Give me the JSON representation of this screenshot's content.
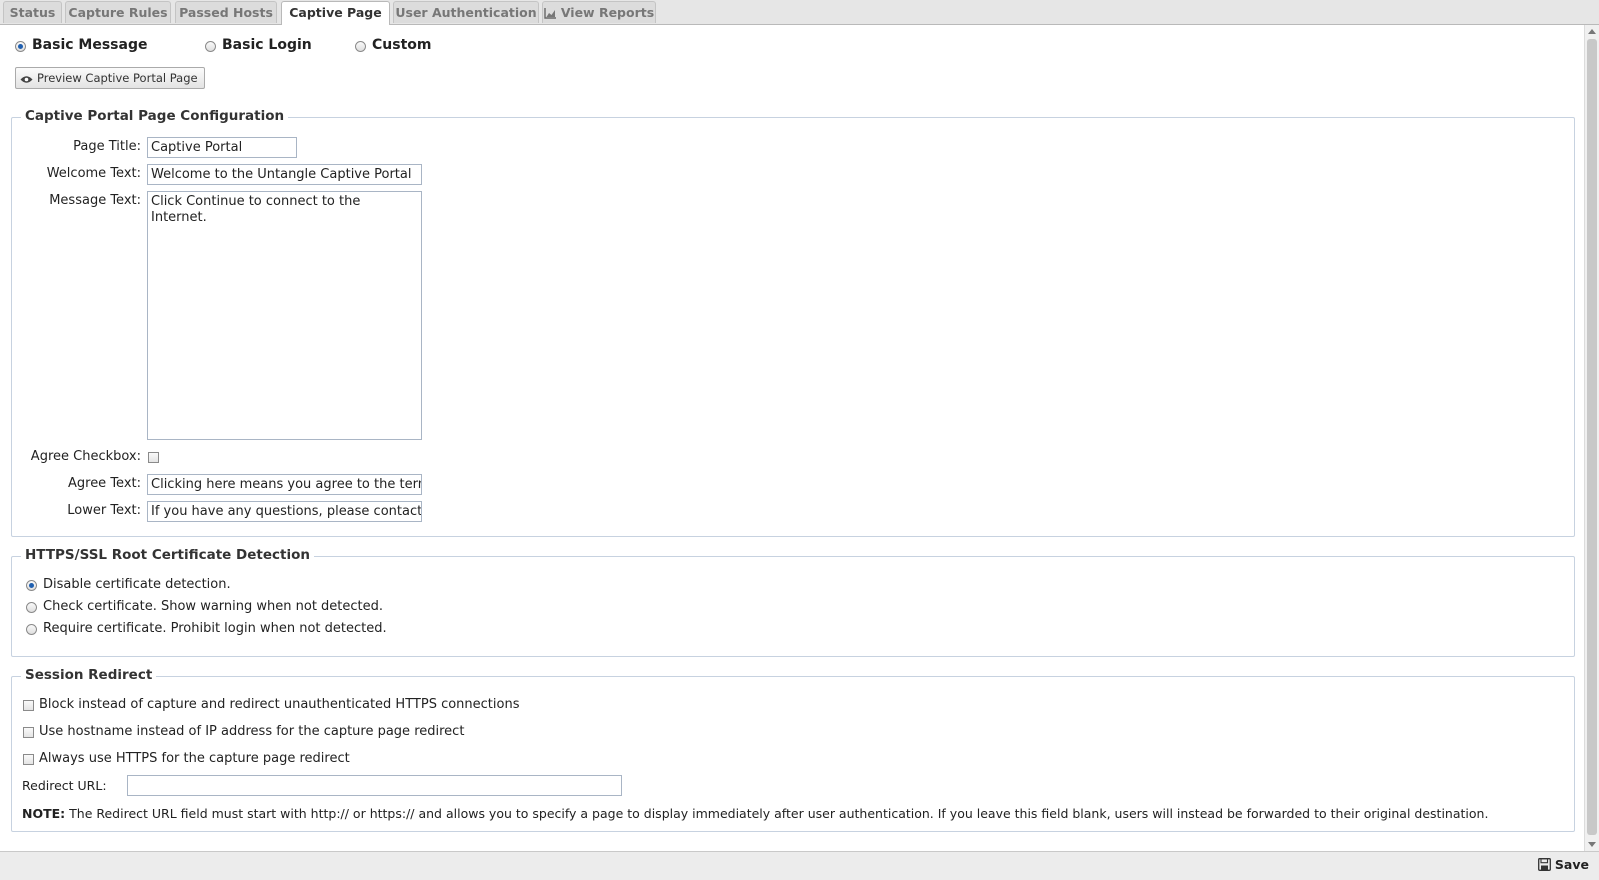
{
  "tabs": [
    {
      "label": "Status"
    },
    {
      "label": "Capture Rules"
    },
    {
      "label": "Passed Hosts"
    },
    {
      "label": "Captive Page"
    },
    {
      "label": "User Authentication"
    },
    {
      "label": "View Reports",
      "icon": "chart-icon"
    }
  ],
  "active_tab": "Captive Page",
  "page_type": {
    "options": [
      "Basic Message",
      "Basic Login",
      "Custom"
    ],
    "selected": "Basic Message"
  },
  "preview_button": {
    "label": "Preview Captive Portal Page",
    "icon": "eye-icon"
  },
  "config": {
    "legend": "Captive Portal Page Configuration",
    "page_title_label": "Page Title:",
    "page_title_value": "Captive Portal",
    "welcome_label": "Welcome Text:",
    "welcome_value": "Welcome to the Untangle Captive Portal",
    "message_label": "Message Text:",
    "message_value": "Click Continue to connect to the Internet.",
    "agree_checkbox_label": "Agree Checkbox:",
    "agree_checked": false,
    "agree_text_label": "Agree Text:",
    "agree_text_value": "Clicking here means you agree to the term",
    "lower_text_label": "Lower Text:",
    "lower_text_value": "If you have any questions, please contact y"
  },
  "ssl": {
    "legend": "HTTPS/SSL Root Certificate Detection",
    "options": [
      "Disable certificate detection.",
      "Check certificate. Show warning when not detected.",
      "Require certificate. Prohibit login when not detected."
    ],
    "selected": "Disable certificate detection."
  },
  "session": {
    "legend": "Session Redirect",
    "checkboxes": [
      {
        "label": "Block instead of capture and redirect unauthenticated HTTPS connections",
        "checked": false
      },
      {
        "label": "Use hostname instead of IP address for the capture page redirect",
        "checked": false
      },
      {
        "label": "Always use HTTPS for the capture page redirect",
        "checked": false
      }
    ],
    "redirect_label": "Redirect URL:",
    "redirect_value": "",
    "note_bold": "NOTE:",
    "note_text": "The Redirect URL field must start with http:// or https:// and allows you to specify a page to display immediately after user authentication. If you leave this field blank, users will instead be forwarded to their original destination."
  },
  "footer": {
    "save_label": "Save",
    "icon": "save-icon"
  }
}
